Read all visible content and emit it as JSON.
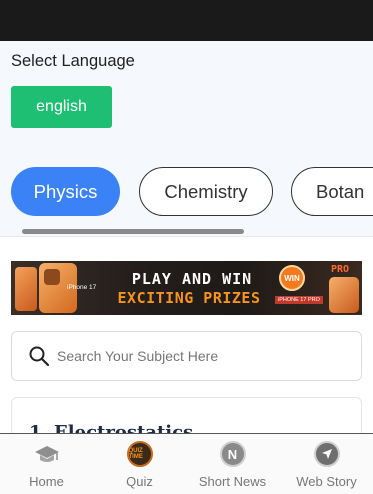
{
  "language": {
    "title": "Select Language",
    "selected": "english"
  },
  "subjects": {
    "chips": [
      "Physics",
      "Chemistry",
      "Botan"
    ],
    "active_index": 0,
    "scroll_position": 0.25
  },
  "banner": {
    "phone_label": "iPhone 17",
    "line1": "PLAY AND WIN",
    "line2": "EXCITING PRIZES",
    "badge": "WIN",
    "badge_sub": "iPHONE 17 PRO",
    "pro_label": "PRO"
  },
  "search": {
    "placeholder": "Search Your Subject Here"
  },
  "topic": {
    "title": "1. Electrostatics"
  },
  "nav": {
    "items": [
      {
        "label": "Home",
        "icon": "graduation-cap-icon"
      },
      {
        "label": "Quiz",
        "icon": "quiz-time-icon",
        "icon_text": "QUIZ TIME"
      },
      {
        "label": "Short News",
        "icon": "news-n-icon",
        "icon_text": "N"
      },
      {
        "label": "Web Story",
        "icon": "compass-icon"
      }
    ]
  },
  "colors": {
    "accent": "#3b82f6",
    "language_button": "#1fbf73",
    "status_bar": "#1a1a1a"
  }
}
